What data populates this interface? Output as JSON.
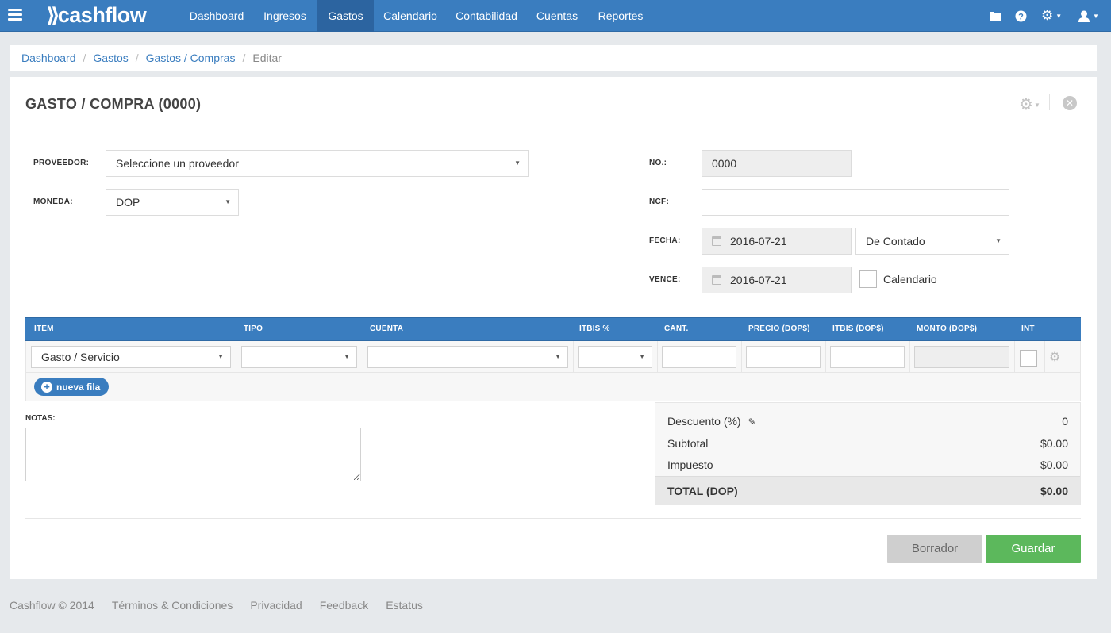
{
  "nav": {
    "brand": "cashflow",
    "items": [
      {
        "label": "Dashboard"
      },
      {
        "label": "Ingresos"
      },
      {
        "label": "Gastos"
      },
      {
        "label": "Calendario"
      },
      {
        "label": "Contabilidad"
      },
      {
        "label": "Cuentas"
      },
      {
        "label": "Reportes"
      }
    ],
    "active": "Gastos",
    "icons": [
      "folder-icon",
      "help-icon",
      "gear-icon",
      "user-icon"
    ]
  },
  "breadcrumb": {
    "items": [
      "Dashboard",
      "Gastos",
      "Gastos / Compras"
    ],
    "current": "Editar"
  },
  "form": {
    "title": "GASTO / COMPRA (0000)",
    "proveedor_label": "PROVEEDOR:",
    "proveedor_value": "Seleccione un proveedor",
    "moneda_label": "MONEDA:",
    "moneda_value": "DOP",
    "no_label": "NO.:",
    "no_value": "0000",
    "ncf_label": "NCF:",
    "ncf_value": "",
    "fecha_label": "FECHA:",
    "fecha_value": "2016-07-21",
    "condicion_value": "De Contado",
    "vence_label": "VENCE:",
    "vence_value": "2016-07-21",
    "calendario_label": "Calendario"
  },
  "table": {
    "headers": [
      "ITEM",
      "TIPO",
      "CUENTA",
      "ITBIS %",
      "CANT.",
      "PRECIO (DOP$)",
      "ITBIS (DOP$)",
      "MONTO (DOP$)",
      "INT"
    ],
    "row": {
      "item": "Gasto / Servicio",
      "tipo": "",
      "cuenta": "",
      "itbis_pct": "",
      "cant": "",
      "precio": "",
      "itbis": "",
      "monto": ""
    },
    "add_label": "nueva fila"
  },
  "notes": {
    "label": "NOTAS:",
    "value": ""
  },
  "totals": {
    "descuento_label": "Descuento (%)",
    "descuento_value": "0",
    "subtotal_label": "Subtotal",
    "subtotal_value": "$0.00",
    "impuesto_label": "Impuesto",
    "impuesto_value": "$0.00",
    "total_label": "TOTAL (DOP)",
    "total_value": "$0.00"
  },
  "actions": {
    "draft_label": "Borrador",
    "save_label": "Guardar"
  },
  "footer": {
    "copyright": "Cashflow © 2014",
    "links": [
      "Términos & Condiciones",
      "Privacidad",
      "Feedback",
      "Estatus"
    ]
  },
  "colors": {
    "primary": "#3a7dbf",
    "active_nav": "#2c64a0",
    "success": "#5cb85c",
    "draft": "#cfcfcf"
  }
}
